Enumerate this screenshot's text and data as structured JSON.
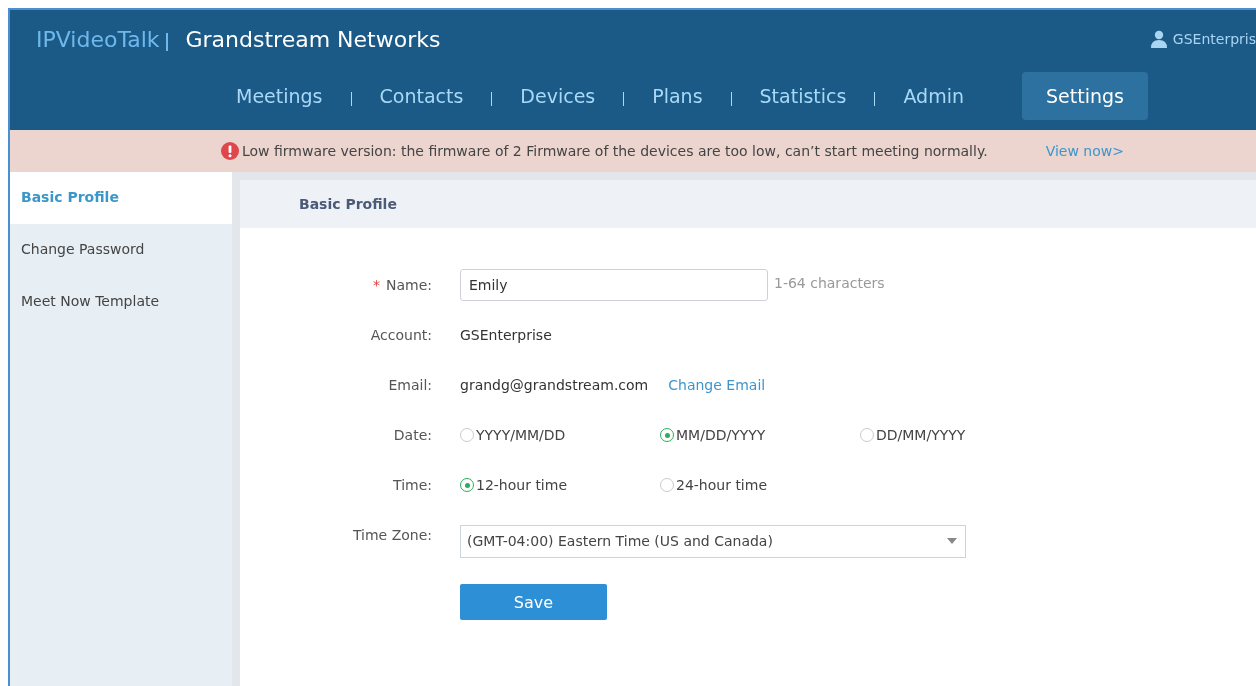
{
  "header": {
    "brand": "IPVideoTalk",
    "organization": "Grandstream Networks",
    "user": "GSEnterpris"
  },
  "nav": [
    {
      "label": "Meetings",
      "selected": false
    },
    {
      "label": "Contacts",
      "selected": false
    },
    {
      "label": "Devices",
      "selected": false
    },
    {
      "label": "Plans",
      "selected": false
    },
    {
      "label": "Statistics",
      "selected": false
    },
    {
      "label": "Admin",
      "selected": false
    },
    {
      "label": "Settings",
      "selected": true
    }
  ],
  "banner": {
    "text": "Low firmware version: the firmware of 2 Firmware of the devices are too low, can’t start meeting normally.",
    "link": "View now>"
  },
  "sidebar": {
    "items": [
      {
        "label": "Basic Profile",
        "selected": true
      },
      {
        "label": "Change Password",
        "selected": false
      },
      {
        "label": "Meet Now Template",
        "selected": false
      }
    ]
  },
  "section_title": "Basic Profile",
  "form": [
    {
      "kind": "input",
      "label": "Name:",
      "required_mark": "*",
      "value": "Emily",
      "hint": "1-64 characters"
    },
    {
      "kind": "text",
      "label": "Account:",
      "value": "GSEnterprise"
    },
    {
      "kind": "text",
      "label": "Email:",
      "value": "grandg@grandstream.com",
      "link": "Change Email"
    },
    {
      "kind": "radio",
      "label": "Date:",
      "options": [
        {
          "label": "YYYY/MM/DD",
          "selected": false
        },
        {
          "label": "MM/DD/YYYY",
          "selected": true
        },
        {
          "label": "DD/MM/YYYY",
          "selected": false
        }
      ]
    },
    {
      "kind": "radio",
      "label": "Time:",
      "options": [
        {
          "label": "12-hour time",
          "selected": true
        },
        {
          "label": "24-hour time",
          "selected": false
        }
      ]
    },
    {
      "kind": "select",
      "label": "Time Zone:",
      "value": "(GMT-04:00) Eastern Time (US and Canada)"
    }
  ],
  "save_button": "Save"
}
